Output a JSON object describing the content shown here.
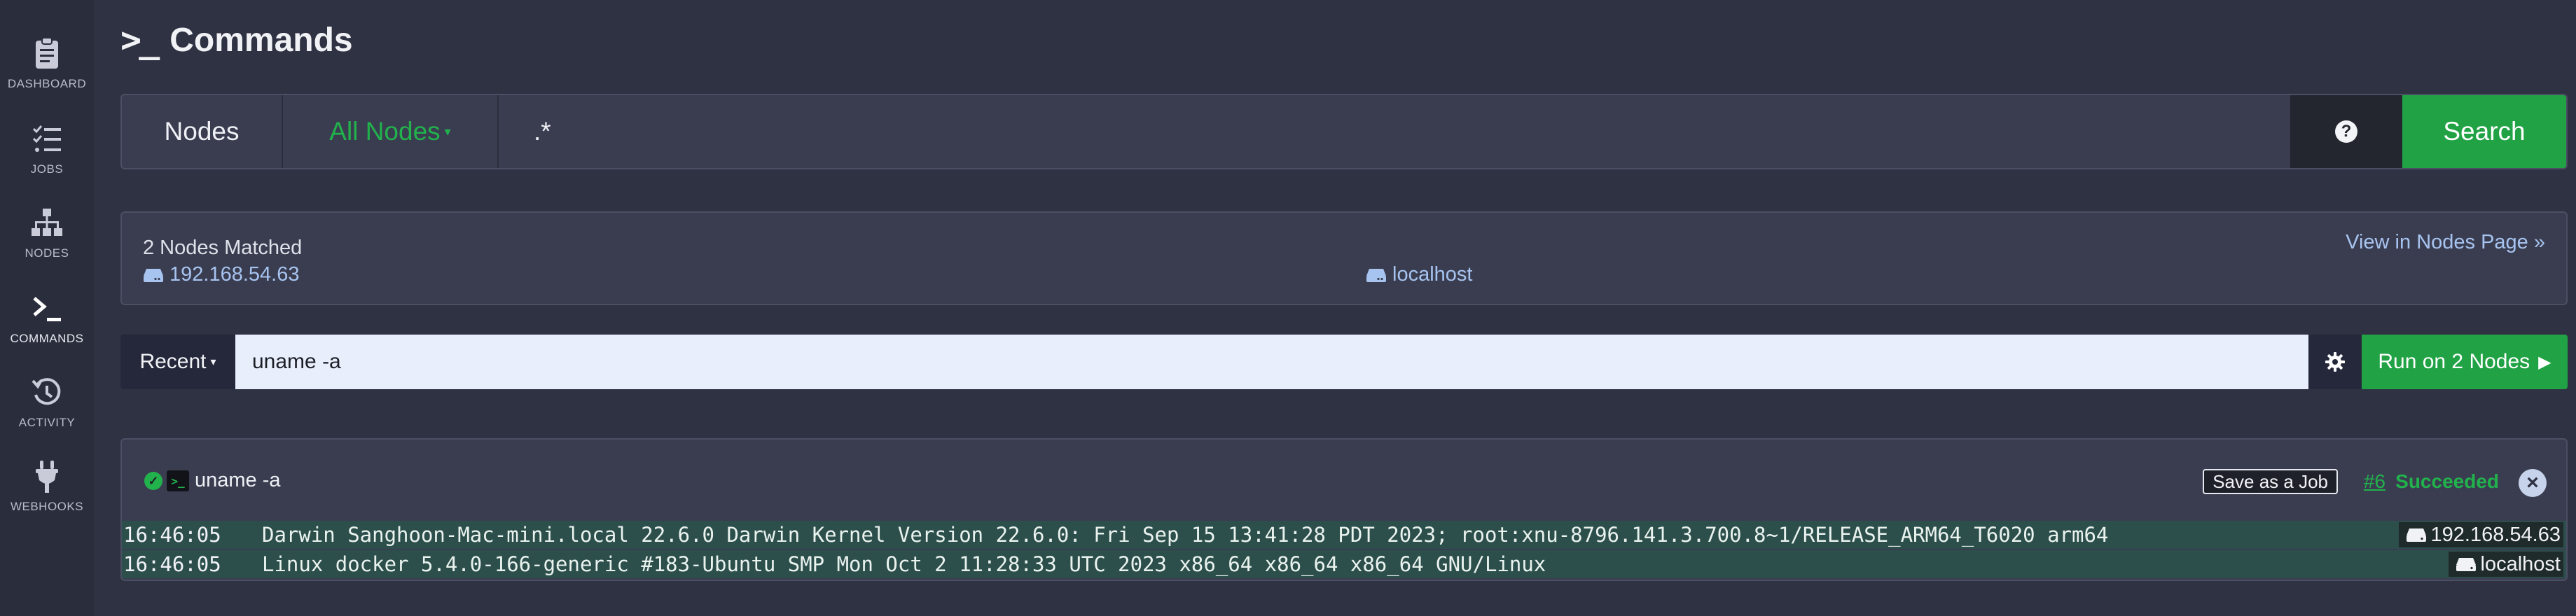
{
  "sidebar": {
    "items": [
      {
        "label": "DASHBOARD",
        "icon": "clipboard-icon"
      },
      {
        "label": "JOBS",
        "icon": "checklist-icon"
      },
      {
        "label": "NODES",
        "icon": "sitemap-icon"
      },
      {
        "label": "COMMANDS",
        "icon": "terminal-icon",
        "active": true
      },
      {
        "label": "ACTIVITY",
        "icon": "history-icon"
      },
      {
        "label": "WEBHOOKS",
        "icon": "plug-icon"
      }
    ]
  },
  "page": {
    "title_icon": ">_",
    "title": "Commands"
  },
  "search": {
    "nodes_label": "Nodes",
    "filter_label": "All Nodes",
    "filter_value": ".*",
    "help_glyph": "?",
    "search_label": "Search"
  },
  "matched": {
    "count_text": "2 Nodes Matched",
    "view_link": "View in Nodes Page »",
    "nodes": [
      "192.168.54.63",
      "localhost"
    ]
  },
  "command": {
    "recent_label": "Recent",
    "value": "uname -a",
    "run_label": "Run on 2 Nodes"
  },
  "output": {
    "command": "uname -a",
    "save_job_label": "Save as a Job",
    "execution_link": "#6",
    "status": "Succeeded",
    "close_glyph": "×",
    "lines": [
      {
        "time": "16:46:05",
        "text": "Darwin Sanghoon-Mac-mini.local 22.6.0 Darwin Kernel Version 22.6.0: Fri Sep 15 13:41:28 PDT 2023; root:xnu-8796.141.3.700.8~1/RELEASE_ARM64_T6020 arm64",
        "node": "192.168.54.63"
      },
      {
        "time": "16:46:05",
        "text": "Linux docker 5.4.0-166-generic #183-Ubuntu SMP Mon Oct 2 11:28:33 UTC 2023 x86_64 x86_64 x86_64 GNU/Linux",
        "node": "localhost"
      }
    ]
  },
  "colors": {
    "background": "#2f3242",
    "sidebar": "#2a2d3b",
    "accent_green": "#21a345",
    "link_blue": "#a7c4f0",
    "output_row": "#2c4f4c"
  }
}
